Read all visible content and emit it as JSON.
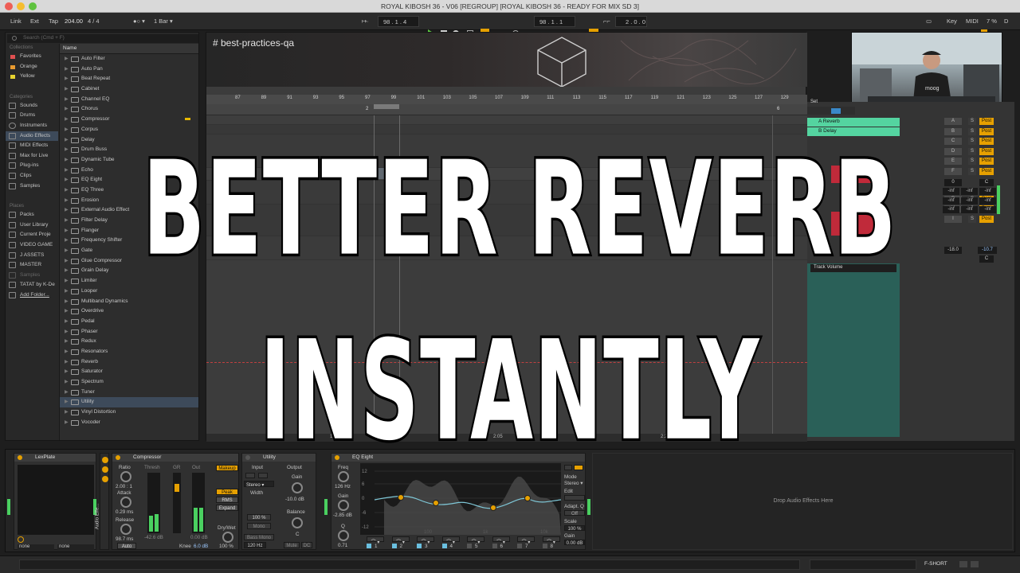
{
  "window": {
    "title": "ROYAL KIBOSH 36 - V06 [REGROUP]  [ROYAL KIBOSH 36 - READY FOR MIX SD 3]"
  },
  "controlbar": {
    "link": "Link",
    "ext": "Ext",
    "tap": "Tap",
    "tempo": "204.00",
    "signature": "4 / 4",
    "metro": "●○ ▾",
    "quantize": "1 Bar ▾",
    "position": "98 .  1 .  4",
    "loop_start": "98 .  1 .  1",
    "loop_length": "2 .  0 .  0",
    "key": "Key",
    "midi": "MIDI",
    "cpu": "7 %",
    "d_label": "D"
  },
  "browser": {
    "search_placeholder": "Search (Cmd + F)",
    "collections_header": "Collections",
    "collections": [
      {
        "label": "Favorites",
        "color": "#e05050"
      },
      {
        "label": "Orange",
        "color": "#e89a30"
      },
      {
        "label": "Yellow",
        "color": "#e6d230"
      }
    ],
    "categories_header": "Categories",
    "categories": [
      "Sounds",
      "Drums",
      "Instruments",
      "Audio Effects",
      "MIDI Effects",
      "Max for Live",
      "Plug-ins",
      "Clips",
      "Samples"
    ],
    "places_header": "Places",
    "places": [
      "Packs",
      "User Library",
      "Current Proje",
      "VIDEO GAME",
      "J ASSETS",
      "MASTER",
      "Samples",
      "TATAT by K-De",
      "Add Folder..."
    ],
    "column_header": "Name",
    "items": [
      "Auto Filter",
      "Auto Pan",
      "Beat Repeat",
      "Cabinet",
      "Channel EQ",
      "Chorus",
      "Compressor",
      "Corpus",
      "Delay",
      "Drum Buss",
      "Dynamic Tube",
      "Echo",
      "EQ Eight",
      "EQ Three",
      "Erosion",
      "External Audio Effect",
      "Filter Delay",
      "Flanger",
      "Frequency Shifter",
      "Gate",
      "Glue Compressor",
      "Grain Delay",
      "Limiter",
      "Looper",
      "Multiband Dynamics",
      "Overdrive",
      "Pedal",
      "Phaser",
      "Redux",
      "Resonators",
      "Reverb",
      "Saturator",
      "Spectrum",
      "Tuner",
      "Utility",
      "Vinyl Distortion",
      "Vocoder"
    ]
  },
  "arrangement": {
    "title": "# best-practices-qa",
    "ruler": [
      "87",
      "89",
      "91",
      "93",
      "95",
      "97",
      "99",
      "101",
      "103",
      "105",
      "107",
      "109",
      "111",
      "113",
      "115",
      "117",
      "119",
      "121",
      "123",
      "125",
      "127",
      "129"
    ],
    "loop_marker_left": "2",
    "loop_marker_right": "6",
    "bottom_times": [
      "1:50",
      "2:05",
      "2:20"
    ],
    "set_label": "Set"
  },
  "mixer": {
    "sends": [
      "A Reverb",
      "B Delay"
    ],
    "send_letters": [
      "A",
      "B",
      "C",
      "D",
      "E",
      "F",
      "G",
      "H",
      "I"
    ],
    "solo": "S",
    "post": "Post",
    "zero": "0",
    "c_label": "C",
    "inf": "-inf",
    "vol_left": "-18.0",
    "vol_right": "-10.7",
    "automation": "Track Volume"
  },
  "devices": {
    "lexplate": {
      "title": "LexPlate",
      "none1": "none",
      "none2": "none"
    },
    "rack_label": "Audio Effe...",
    "compressor": {
      "title": "Compressor",
      "ratio_label": "Ratio",
      "ratio": "2.00 : 1",
      "attack_label": "Attack",
      "attack": "0.29 ms",
      "release_label": "Release",
      "release": "98.7 ms",
      "auto": "Auto",
      "thresh": "Thresh",
      "gr": "GR",
      "out": "Out",
      "thresh_val": "-42.6 dB",
      "out_val": "0.00 dB",
      "makeup": "Makeup",
      "peak": "Peak",
      "rms": "RMS",
      "expand": "Expand",
      "knee_label": "Knee",
      "knee": "6.0 dB",
      "drywet_label": "Dry/Wet",
      "drywet": "100 %"
    },
    "utility": {
      "title": "Utility",
      "input": "Input",
      "output": "Output",
      "stereo": "Stereo ▾",
      "width_label": "Width",
      "width": "100 %",
      "mono": "Mono",
      "bass_mono": "Bass Mono",
      "bass_freq": "120 Hz",
      "gain_label": "Gain",
      "gain": "-10.0 dB",
      "balance_label": "Balance",
      "balance": "C",
      "mute": "Mute",
      "dc": "DC"
    },
    "eq": {
      "title": "EQ Eight",
      "freq_label": "Freq",
      "freq": "126 Hz",
      "gain_label": "Gain",
      "gain": "-2.85 dB",
      "q_label": "Q",
      "q": "0.71",
      "db_marks": [
        "12",
        "6",
        "0",
        "-6",
        "-12"
      ],
      "freq_marks": [
        "100",
        "1k",
        "10k"
      ],
      "mode_label": "Mode",
      "mode": "Stereo ▾",
      "edit": "Edit",
      "adapt_label": "Adapt. Q",
      "adapt": "Off",
      "scale_label": "Scale",
      "scale": "100 %",
      "gain2_label": "Gain",
      "gain2": "0.00 dB",
      "bands": [
        "1",
        "2",
        "3",
        "4",
        "5",
        "6",
        "7",
        "8"
      ]
    },
    "drop_text": "Drop Audio Effects Here"
  },
  "status": {
    "track": "F-SHORT"
  },
  "overlay": {
    "line1": "BETTER REVERB",
    "line2": "INSTANTLY"
  }
}
